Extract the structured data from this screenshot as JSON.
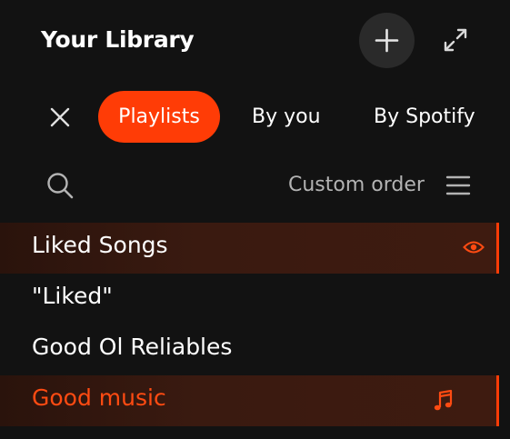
{
  "header": {
    "title": "Your Library"
  },
  "filters": {
    "chips": [
      {
        "label": "Playlists",
        "active": true
      },
      {
        "label": "By you",
        "active": false
      },
      {
        "label": "By Spotify",
        "active": false
      }
    ]
  },
  "sort": {
    "label": "Custom order"
  },
  "library": {
    "items": [
      {
        "label": "Liked Songs",
        "highlighted": true,
        "icon": "eye-icon"
      },
      {
        "label": "\"Liked\"",
        "highlighted": false
      },
      {
        "label": "Good Ol Reliables",
        "highlighted": false
      },
      {
        "label": "Good music",
        "highlighted": true,
        "playing": true,
        "icon": "music-note-icon"
      }
    ]
  },
  "colors": {
    "background": "#121212",
    "accent": "#ff3c06",
    "text": "#ffffff",
    "muted_text": "#b3b3b3",
    "button_bg": "#2a2a2a"
  }
}
